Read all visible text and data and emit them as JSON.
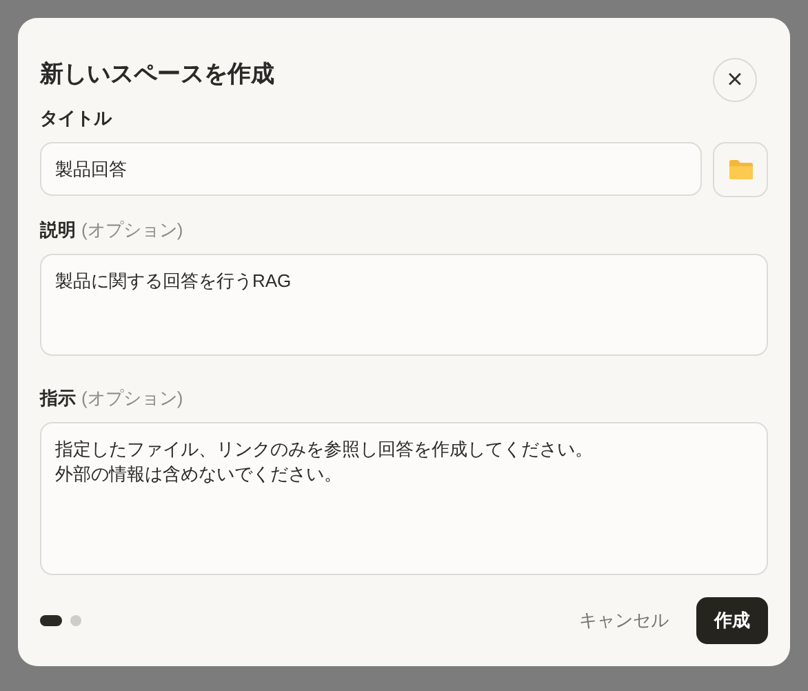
{
  "dialog": {
    "title": "新しいスペースを作成",
    "close": "×"
  },
  "title_field": {
    "label": "タイトル",
    "value": "製品回答"
  },
  "description_field": {
    "label": "説明",
    "optional": "(オプション)",
    "value": "製品に関する回答を行うRAG"
  },
  "instructions_field": {
    "label": "指示",
    "optional": "(オプション)",
    "lines": [
      "指定したファイル、リンクのみを参照し回答を作成してください。",
      "外部の情報は含めないでください。"
    ]
  },
  "steps": [
    {
      "selected": true
    },
    {
      "selected": false
    }
  ],
  "buttons": {
    "cancel": "キャンセル",
    "create": "作成"
  }
}
